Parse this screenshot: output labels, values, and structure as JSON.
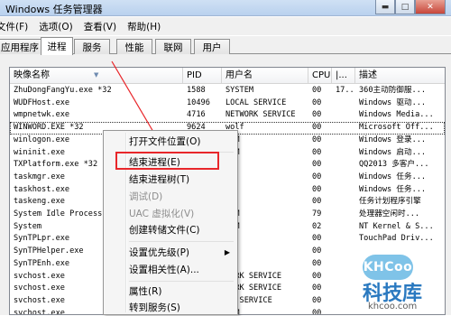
{
  "window": {
    "title": "Windows 任务管理器",
    "buttons": [
      "▬",
      "□",
      "✕"
    ]
  },
  "menubar": [
    "文件(F)",
    "选项(O)",
    "查看(V)",
    "帮助(H)"
  ],
  "tabs": [
    "应用程序",
    "进程",
    "服务",
    "性能",
    "联网",
    "用户"
  ],
  "active_tab": "进程",
  "columns": [
    "映像名称",
    "PID",
    "用户名",
    "CPU",
    "|...",
    "描述"
  ],
  "rows": [
    {
      "name": "ZhuDongFangYu.exe *32",
      "pid": "1588",
      "user": "SYSTEM",
      "cpu": "00",
      "mem": "17...",
      "desc": "360主动防御服..."
    },
    {
      "name": "WUDFHost.exe",
      "pid": "10496",
      "user": "LOCAL SERVICE",
      "cpu": "00",
      "mem": "",
      "desc": "Windows 驱动..."
    },
    {
      "name": "wmpnetwk.exe",
      "pid": "4716",
      "user": "NETWORK SERVICE",
      "cpu": "00",
      "mem": "",
      "desc": "Windows Media..."
    },
    {
      "name": "WINWORD.EXE *32",
      "pid": "9624",
      "user": "wolf",
      "cpu": "00",
      "mem": "",
      "desc": "Microsoft Off..."
    },
    {
      "name": "winlogon.exe",
      "pid": "",
      "user": "TEM",
      "cpu": "00",
      "mem": "",
      "desc": "Windows 登录..."
    },
    {
      "name": "wininit.exe",
      "pid": "",
      "user": "TEM",
      "cpu": "00",
      "mem": "",
      "desc": "Windows 启动..."
    },
    {
      "name": "TXPlatform.exe *32",
      "pid": "",
      "user": "f",
      "cpu": "00",
      "mem": "",
      "desc": "QQ2013 多客户..."
    },
    {
      "name": "taskmgr.exe",
      "pid": "",
      "user": "f",
      "cpu": "00",
      "mem": "",
      "desc": "Windows 任务..."
    },
    {
      "name": "taskhost.exe",
      "pid": "",
      "user": "f",
      "cpu": "00",
      "mem": "",
      "desc": "Windows 任务..."
    },
    {
      "name": "taskeng.exe",
      "pid": "",
      "user": "f",
      "cpu": "00",
      "mem": "",
      "desc": "任务计划程序引擎"
    },
    {
      "name": "System Idle Process",
      "pid": "",
      "user": "TEM",
      "cpu": "79",
      "mem": "",
      "desc": "处理器空闲时..."
    },
    {
      "name": "System",
      "pid": "",
      "user": "TEM",
      "cpu": "02",
      "mem": "",
      "desc": "NT Kernel & S..."
    },
    {
      "name": "SynTPLpr.exe",
      "pid": "",
      "user": "f",
      "cpu": "00",
      "mem": "",
      "desc": "TouchPad Driv..."
    },
    {
      "name": "SynTPHelper.exe",
      "pid": "",
      "user": "f",
      "cpu": "00",
      "mem": "",
      "desc": ""
    },
    {
      "name": "SynTPEnh.exe",
      "pid": "",
      "user": "f",
      "cpu": "00",
      "mem": "",
      "desc": ""
    },
    {
      "name": "svchost.exe",
      "pid": "",
      "user": "WORK SERVICE",
      "cpu": "00",
      "mem": "",
      "desc": ""
    },
    {
      "name": "svchost.exe",
      "pid": "",
      "user": "WORK SERVICE",
      "cpu": "00",
      "mem": "",
      "desc": ""
    },
    {
      "name": "svchost.exe",
      "pid": "",
      "user": "AL SERVICE",
      "cpu": "00",
      "mem": "",
      "desc": ""
    },
    {
      "name": "svchost.exe",
      "pid": "",
      "user": "TEM",
      "cpu": "00",
      "mem": "",
      "desc": ""
    }
  ],
  "context_menu": [
    {
      "label": "打开文件位置(O)",
      "disabled": false
    },
    {
      "label": "结束进程(E)",
      "disabled": false
    },
    {
      "label": "结束进程树(T)",
      "disabled": false
    },
    {
      "label": "调试(D)",
      "disabled": true
    },
    {
      "label": "UAC 虚拟化(V)",
      "disabled": true
    },
    {
      "label": "创建转储文件(C)",
      "disabled": false
    },
    {
      "label": "设置优先级(P)",
      "disabled": false,
      "submenu": true
    },
    {
      "label": "设置相关性(A)...",
      "disabled": false
    },
    {
      "label": "属性(R)",
      "disabled": false
    },
    {
      "label": "转到服务(S)",
      "disabled": false
    }
  ],
  "watermark": {
    "logo": "KHCoo",
    "brand": "科技库",
    "url": "khcoo.com"
  },
  "colors": {
    "highlight": "#e8262a",
    "titlebar": "#c4d8f0"
  }
}
